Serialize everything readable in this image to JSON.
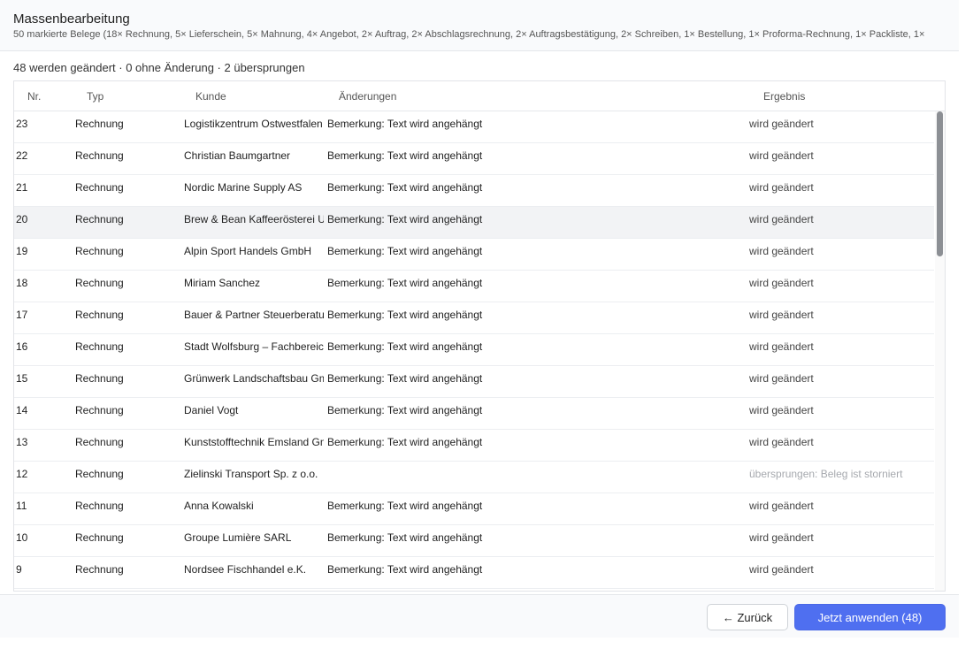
{
  "header": {
    "title": "Massenbearbeitung",
    "subtitle": "50 markierte Belege (18× Rechnung, 5× Lieferschein, 5× Mahnung, 4× Angebot, 2× Auftrag, 2× Abschlagsrechnung, 2× Auftragsbestätigung, 2× Schreiben, 1× Bestellung, 1× Proforma-Rechnung, 1× Packliste, 1×"
  },
  "summary": "48 werden geändert · 0 ohne Änderung · 2 übersprungen",
  "table": {
    "columns": [
      "Nr.",
      "Typ",
      "Kunde",
      "Änderungen",
      "Ergebnis"
    ],
    "rows": [
      {
        "nr": "23",
        "typ": "Rechnung",
        "kunde": "Logistikzentrum Ostwestfalen GmbH",
        "aenderung": "Bemerkung: Text wird angehängt",
        "ergebnis": "wird geändert"
      },
      {
        "nr": "22",
        "typ": "Rechnung",
        "kunde": "Christian Baumgartner",
        "aenderung": "Bemerkung: Text wird angehängt",
        "ergebnis": "wird geändert"
      },
      {
        "nr": "21",
        "typ": "Rechnung",
        "kunde": "Nordic Marine Supply AS",
        "aenderung": "Bemerkung: Text wird angehängt",
        "ergebnis": "wird geändert"
      },
      {
        "nr": "20",
        "typ": "Rechnung",
        "kunde": "Brew & Bean Kaffeerösterei UG",
        "aenderung": "Bemerkung: Text wird angehängt",
        "ergebnis": "wird geändert"
      },
      {
        "nr": "19",
        "typ": "Rechnung",
        "kunde": "Alpin Sport Handels GmbH",
        "aenderung": "Bemerkung: Text wird angehängt",
        "ergebnis": "wird geändert"
      },
      {
        "nr": "18",
        "typ": "Rechnung",
        "kunde": "Miriam Sanchez",
        "aenderung": "Bemerkung: Text wird angehängt",
        "ergebnis": "wird geändert"
      },
      {
        "nr": "17",
        "typ": "Rechnung",
        "kunde": "Bauer & Partner Steuerberatung",
        "aenderung": "Bemerkung: Text wird angehängt",
        "ergebnis": "wird geändert"
      },
      {
        "nr": "16",
        "typ": "Rechnung",
        "kunde": "Stadt Wolfsburg – Fachbereich",
        "aenderung": "Bemerkung: Text wird angehängt",
        "ergebnis": "wird geändert"
      },
      {
        "nr": "15",
        "typ": "Rechnung",
        "kunde": "Grünwerk Landschaftsbau GmbH",
        "aenderung": "Bemerkung: Text wird angehängt",
        "ergebnis": "wird geändert"
      },
      {
        "nr": "14",
        "typ": "Rechnung",
        "kunde": "Daniel Vogt",
        "aenderung": "Bemerkung: Text wird angehängt",
        "ergebnis": "wird geändert"
      },
      {
        "nr": "13",
        "typ": "Rechnung",
        "kunde": "Kunststofftechnik Emsland GmbH",
        "aenderung": "Bemerkung: Text wird angehängt",
        "ergebnis": "wird geändert"
      },
      {
        "nr": "12",
        "typ": "Rechnung",
        "kunde": "Zielinski Transport Sp. z o.o.",
        "aenderung": "",
        "ergebnis": "übersprungen: Beleg ist storniert",
        "skipped": true
      },
      {
        "nr": "11",
        "typ": "Rechnung",
        "kunde": "Anna Kowalski",
        "aenderung": "Bemerkung: Text wird angehängt",
        "ergebnis": "wird geändert"
      },
      {
        "nr": "10",
        "typ": "Rechnung",
        "kunde": "Groupe Lumière SARL",
        "aenderung": "Bemerkung: Text wird angehängt",
        "ergebnis": "wird geändert"
      },
      {
        "nr": "9",
        "typ": "Rechnung",
        "kunde": "Nordsee Fischhandel e.K.",
        "aenderung": "Bemerkung: Text wird angehängt",
        "ergebnis": "wird geändert"
      }
    ]
  },
  "footer": {
    "back_label": "← Zurück",
    "apply_label": "Jetzt anwenden (48)"
  },
  "colors": {
    "accent": "#4f6ff0",
    "skipped_text": "#a6a9ae"
  }
}
